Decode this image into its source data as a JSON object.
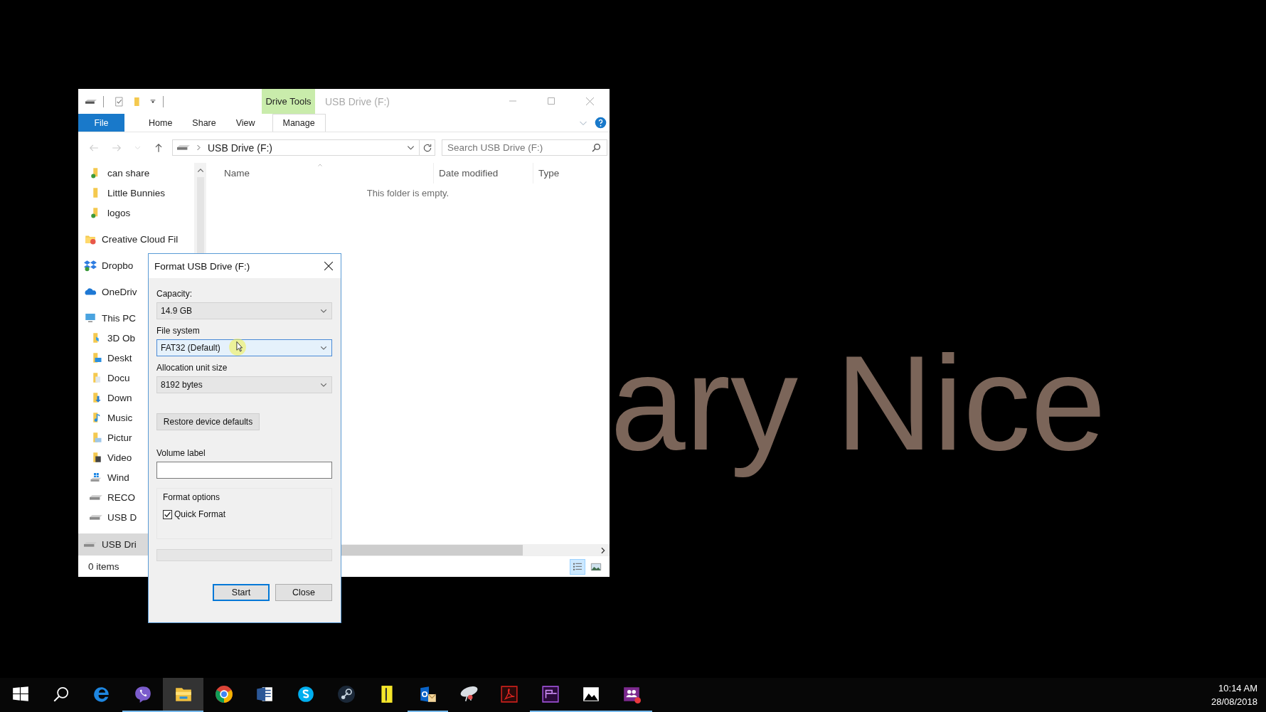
{
  "wallpaper_text": "ary Nice",
  "explorer": {
    "title": "USB Drive (F:)",
    "contextual_tab": "Drive Tools",
    "ribbon_tabs": [
      {
        "label": "File",
        "kind": "file",
        "selected": false
      },
      {
        "label": "Home",
        "kind": "tab",
        "selected": false
      },
      {
        "label": "Share",
        "kind": "tab",
        "selected": false
      },
      {
        "label": "View",
        "kind": "tab",
        "selected": false
      },
      {
        "label": "Manage",
        "kind": "tab",
        "selected": true
      }
    ],
    "address": {
      "path": "USB Drive (F:)"
    },
    "search": {
      "placeholder": "Search USB Drive (F:)"
    },
    "sidebar": {
      "quick_access_children": [
        {
          "label": "can share",
          "kind": "shared-folder",
          "selected": false
        },
        {
          "label": "Little Bunnies",
          "kind": "folder",
          "selected": false
        },
        {
          "label": "logos",
          "kind": "shared-folder",
          "selected": false
        }
      ],
      "items": [
        {
          "label": "Creative Cloud Fil",
          "kind": "cc-folder",
          "selected": false
        },
        {
          "label": "Dropbo",
          "kind": "dropbox",
          "selected": false
        },
        {
          "label": "OneDriv",
          "kind": "onedrive",
          "selected": false
        },
        {
          "label": "This PC",
          "kind": "pc",
          "selected": false,
          "children": [
            {
              "label": "3D Ob",
              "kind": "objects",
              "selected": false
            },
            {
              "label": "Deskt",
              "kind": "desktop",
              "selected": false
            },
            {
              "label": "Docu",
              "kind": "documents",
              "selected": false
            },
            {
              "label": "Down",
              "kind": "downloads",
              "selected": false
            },
            {
              "label": "Music",
              "kind": "music",
              "selected": false
            },
            {
              "label": "Pictur",
              "kind": "pictures",
              "selected": false
            },
            {
              "label": "Video",
              "kind": "videos",
              "selected": false
            },
            {
              "label": "Wind",
              "kind": "system-drive",
              "selected": false
            },
            {
              "label": "RECO",
              "kind": "drive",
              "selected": false
            },
            {
              "label": "USB D",
              "kind": "drive",
              "selected": false
            }
          ]
        },
        {
          "label": "USB Dri",
          "kind": "drive",
          "selected": true
        }
      ]
    },
    "columns": [
      {
        "label": "Name",
        "sorted": true
      },
      {
        "label": "Date modified",
        "sorted": false
      },
      {
        "label": "Type",
        "sorted": false
      }
    ],
    "empty_message": "This folder is empty.",
    "status": "0 items",
    "views": [
      {
        "kind": "details",
        "selected": true
      },
      {
        "kind": "tiles",
        "selected": false
      }
    ]
  },
  "dialog": {
    "title": "Format USB Drive (F:)",
    "fields": [
      {
        "label": "Capacity:",
        "value": "14.9 GB",
        "focused": false
      },
      {
        "label": "File system",
        "value": "FAT32 (Default)",
        "focused": true
      },
      {
        "label": "Allocation unit size",
        "value": "8192 bytes",
        "focused": false
      }
    ],
    "restore_button": "Restore device defaults",
    "volume_label": {
      "label": "Volume label"
    },
    "format_options": {
      "label": "Format options",
      "options": [
        {
          "label": "Quick Format",
          "checked": true
        }
      ]
    },
    "progress": {
      "level": 0
    },
    "buttons": [
      {
        "label": "Start",
        "default": true
      },
      {
        "label": "Close",
        "default": false
      }
    ]
  },
  "taskbar": {
    "apps": [
      {
        "kind": "start",
        "running": false,
        "selected": false
      },
      {
        "kind": "search",
        "running": false,
        "selected": false
      },
      {
        "kind": "edge",
        "running": false,
        "selected": false
      },
      {
        "kind": "viber",
        "running": true,
        "selected": false
      },
      {
        "kind": "explorer",
        "running": true,
        "selected": true
      },
      {
        "kind": "chrome",
        "running": false,
        "selected": false
      },
      {
        "kind": "word",
        "running": false,
        "selected": false
      },
      {
        "kind": "skype",
        "running": false,
        "selected": false
      },
      {
        "kind": "steam",
        "running": false,
        "selected": false
      },
      {
        "kind": "notes",
        "running": false,
        "selected": false
      },
      {
        "kind": "outlook",
        "running": true,
        "selected": false
      },
      {
        "kind": "dish",
        "running": false,
        "selected": false
      },
      {
        "kind": "acrobat",
        "running": false,
        "selected": false
      },
      {
        "kind": "premiere",
        "running": true,
        "selected": false
      },
      {
        "kind": "photos",
        "running": true,
        "selected": false
      },
      {
        "kind": "teams",
        "running": true,
        "selected": false
      }
    ],
    "clock": {
      "time": "10:14 AM",
      "date": "28/08/2018"
    }
  }
}
